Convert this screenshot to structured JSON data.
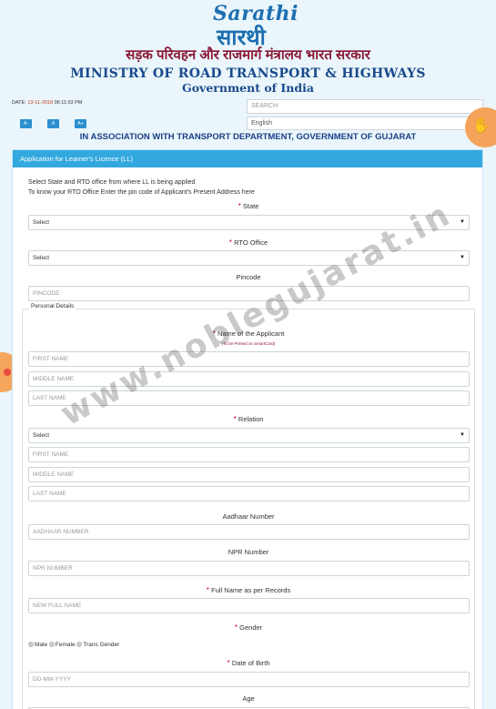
{
  "header": {
    "logo_latin": "Sarathi",
    "logo_hindi": "सारथी",
    "hindi_line": "सड़क परिवहन और राजमार्ग मंत्रालय भारत सरकार",
    "ministry": "MINISTRY OF ROAD TRANSPORT & HIGHWAYS",
    "government": "Government of India"
  },
  "toolbar": {
    "date_label": "DATE:",
    "date_value": "13-11-2018",
    "time_value": "06:11:03 PM",
    "font_buttons": [
      "A-",
      "A",
      "A+"
    ],
    "search_placeholder": "SEARCH",
    "language": "English"
  },
  "association": "IN ASSOCIATION WITH TRANSPORT DEPARTMENT, GOVERNMENT OF GUJARAT",
  "form": {
    "title": "Application for Learner's Licence (LL)",
    "intro_1": "Select State and RTO office from where LL is being applied",
    "intro_2": "To know your RTO Office Enter the pin code of Applicant's Present Address here",
    "state_label": "State",
    "state_value": "Select",
    "rto_label": "RTO Office",
    "rto_value": "Select",
    "pincode_label": "Pincode",
    "pincode_placeholder": "PINCODE",
    "personal_legend": "Personal Details",
    "applicant_label": "Name of the Applicant",
    "applicant_note": "(To be Printed on SmartCard)",
    "first_name": "FIRST NAME",
    "middle_name": "MIDDLE NAME",
    "last_name": "LAST NAME",
    "relation_label": "Relation",
    "relation_value": "Select",
    "rel_first_name": "FIRST NAME",
    "rel_middle_name": "MIDDLE NAME",
    "rel_last_name": "LAST NAME",
    "aadhaar_label": "Aadhaar Number",
    "aadhaar_placeholder": "AADHAAR NUMBER",
    "npr_label": "NPR Number",
    "npr_placeholder": "NPR NUMBER",
    "fullname_label": "Full Name as per Records",
    "fullname_placeholder": "NEW FULL NAME",
    "gender_label": "Gender",
    "gender_options": [
      "Male",
      "Female",
      "Trans Gender"
    ],
    "dob_label": "Date of Birth",
    "dob_placeholder": "DD-MM-YYYY",
    "age_label": "Age"
  },
  "watermark": "www.noblegujarat.in",
  "colors": {
    "accent": "#33a8df",
    "ministry": "#1a4a8c",
    "required": "#d0021b"
  }
}
